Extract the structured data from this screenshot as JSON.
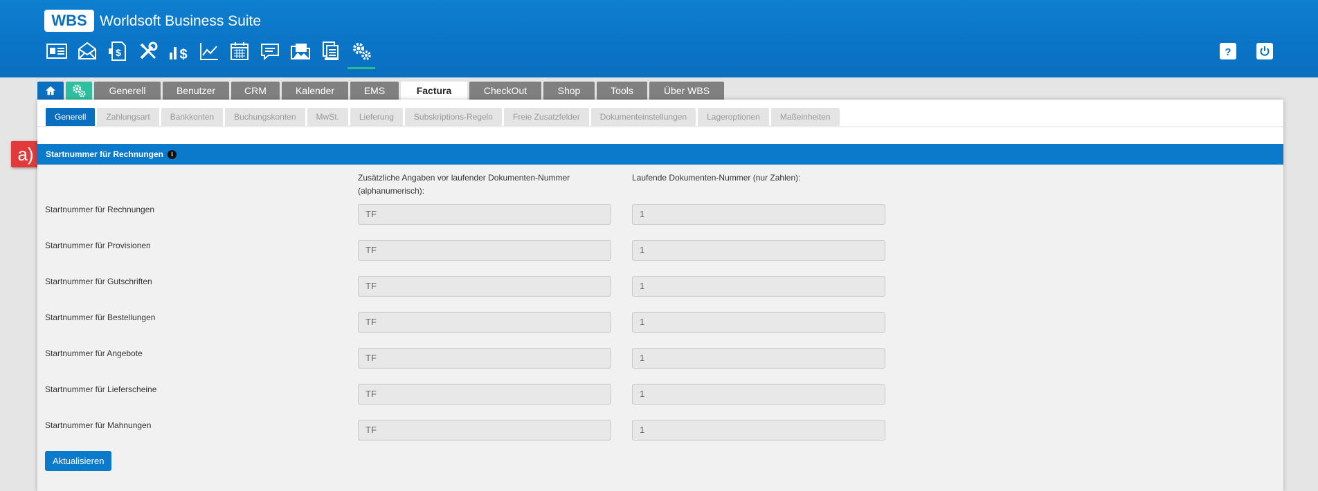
{
  "app": {
    "logo": "WBS",
    "title": "Worldsoft Business Suite"
  },
  "toolbar": {
    "icons": [
      "contact-card-icon",
      "mail-icon",
      "invoice-icon",
      "tools-icon",
      "chart-dollar-icon",
      "line-chart-icon",
      "calendar-icon",
      "chat-icon",
      "folder-images-icon",
      "document-stack-icon",
      "settings-gears-icon"
    ],
    "active": "settings-gears-icon"
  },
  "header_right": {
    "help_icon": "help-icon",
    "power_icon": "power-icon"
  },
  "main_tabs": [
    "Generell",
    "Benutzer",
    "CRM",
    "Kalender",
    "EMS",
    "Factura",
    "CheckOut",
    "Shop",
    "Tools",
    "Über WBS"
  ],
  "main_tab_active": "Factura",
  "sub_tabs": [
    "Generell",
    "Zahlungsart",
    "Bankkonten",
    "Buchungskonten",
    "MwSt.",
    "Lieferung",
    "Subskriptions-Regeln",
    "Freie Zusatzfelder",
    "Dokumenteinstellungen",
    "Lageroptionen",
    "Maßeinheiten"
  ],
  "sub_tab_active": "Generell",
  "marker": "a)",
  "section": {
    "title": "Startnummer für Rechnungen"
  },
  "columns": {
    "prefix": "Zusätzliche Angaben vor laufender Dokumenten-Nummer (alphanumerisch):",
    "number": "Laufende Dokumenten-Nummer (nur Zahlen):"
  },
  "rows": [
    {
      "label": "Startnummer für Rechnungen",
      "prefix": "TF",
      "number": "1"
    },
    {
      "label": "Startnummer für Provisionen",
      "prefix": "TF",
      "number": "1"
    },
    {
      "label": "Startnummer für Gutschriften",
      "prefix": "TF",
      "number": "1"
    },
    {
      "label": "Startnummer für Bestellungen",
      "prefix": "TF",
      "number": "1"
    },
    {
      "label": "Startnummer für Angebote",
      "prefix": "TF",
      "number": "1"
    },
    {
      "label": "Startnummer für Lieferscheine",
      "prefix": "TF",
      "number": "1"
    },
    {
      "label": "Startnummer für Mahnungen",
      "prefix": "TF",
      "number": "1"
    }
  ],
  "update_button": "Aktualisieren",
  "colors": {
    "brand_blue": "#0b6fbf",
    "section_blue": "#0b7acb",
    "accent_green": "#2dbd8b",
    "marker_red": "#e23a3a"
  }
}
